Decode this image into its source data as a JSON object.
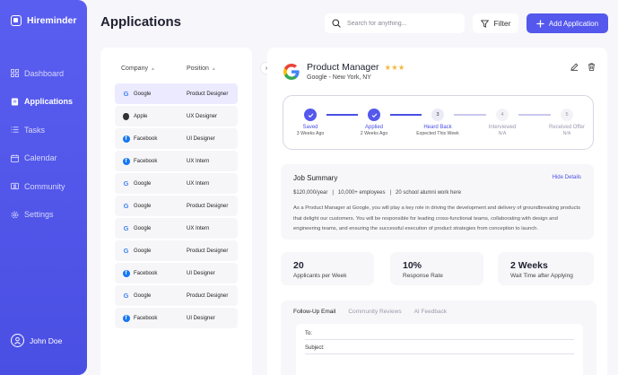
{
  "app": {
    "name": "Hireminder"
  },
  "sidebar": {
    "items": [
      {
        "label": "Dashboard",
        "icon": "dashboard-icon",
        "active": false
      },
      {
        "label": "Applications",
        "icon": "document-icon",
        "active": true
      },
      {
        "label": "Tasks",
        "icon": "tasks-icon",
        "active": false
      },
      {
        "label": "Calendar",
        "icon": "calendar-icon",
        "active": false
      },
      {
        "label": "Community",
        "icon": "community-icon",
        "active": false
      },
      {
        "label": "Settings",
        "icon": "gear-icon",
        "active": false
      }
    ],
    "user": {
      "name": "John Doe"
    }
  },
  "header": {
    "title": "Applications",
    "search_placeholder": "Search for anything...",
    "filter_label": "Filter",
    "add_label": "Add Application"
  },
  "list": {
    "columns": [
      "Company",
      "Position"
    ],
    "rows": [
      {
        "company": "Google",
        "logo": "google",
        "position": "Product Designer",
        "selected": true
      },
      {
        "company": "Apple",
        "logo": "apple",
        "position": "UX Designer",
        "selected": false
      },
      {
        "company": "Facebook",
        "logo": "facebook",
        "position": "UI Designer",
        "selected": false
      },
      {
        "company": "Facebook",
        "logo": "facebook",
        "position": "UX Intern",
        "selected": false
      },
      {
        "company": "Google",
        "logo": "google",
        "position": "UX Intern",
        "selected": false
      },
      {
        "company": "Google",
        "logo": "google",
        "position": "Product Designer",
        "selected": false
      },
      {
        "company": "Google",
        "logo": "google",
        "position": "UX Intern",
        "selected": false
      },
      {
        "company": "Google",
        "logo": "google",
        "position": "Product Designer",
        "selected": false
      },
      {
        "company": "Facebook",
        "logo": "facebook",
        "position": "UI Designer",
        "selected": false
      },
      {
        "company": "Google",
        "logo": "google",
        "position": "Product Designer",
        "selected": false
      },
      {
        "company": "Facebook",
        "logo": "facebook",
        "position": "UI Designer",
        "selected": false
      }
    ]
  },
  "detail": {
    "title": "Product Manager",
    "rating": 3,
    "subtitle": "Google - New York, NY",
    "steps": [
      {
        "label": "Saved",
        "sub": "3 Weeks Ago",
        "state": "done",
        "num": ""
      },
      {
        "label": "Applied",
        "sub": "2 Weeks Ago",
        "state": "done",
        "num": ""
      },
      {
        "label": "Heard Back",
        "sub": "Expected This Week",
        "state": "current",
        "num": "3"
      },
      {
        "label": "Interviewed",
        "sub": "N/A",
        "state": "todo",
        "num": "4"
      },
      {
        "label": "Received Offer",
        "sub": "N/A",
        "state": "todo",
        "num": "5"
      }
    ],
    "summary": {
      "title": "Job Summary",
      "hide_label": "Hide Details",
      "meta": "$120,000/year   |   10,000+ employees   |   20 school alumni work here",
      "description": "As a Product Manager at Google, you will play a key role in driving the development and delivery of groundbreaking products that delight our customers. You will be responsible for leading cross-functional teams, collaborating with design and engineering teams, and ensuring the successful execution of product strategies from conception to launch."
    },
    "stats": [
      {
        "value": "20",
        "label": "Applicants per Week"
      },
      {
        "value": "10%",
        "label": "Response Rate"
      },
      {
        "value": "2 Weeks",
        "label": "Wait Time after Applying"
      }
    ],
    "tabs": [
      "Follow-Up Email",
      "Community Reviews",
      "AI Feedback"
    ],
    "email": {
      "to_label": "To:",
      "subject_label": "Subject:"
    }
  },
  "colors": {
    "accent": "#5458ec",
    "star": "#f5b942"
  }
}
